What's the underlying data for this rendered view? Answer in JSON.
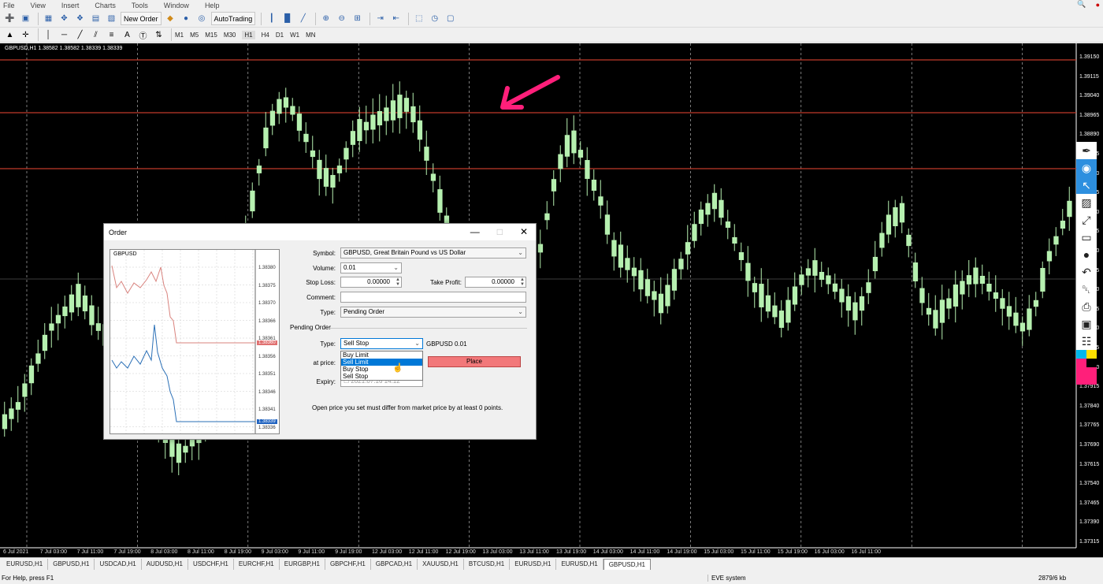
{
  "menu": [
    "File",
    "View",
    "Insert",
    "Charts",
    "Tools",
    "Window",
    "Help"
  ],
  "toolbar": {
    "new_order": "New Order",
    "auto_trading": "AutoTrading",
    "timeframes": [
      "M1",
      "M5",
      "M15",
      "M30",
      "H1",
      "H4",
      "D1",
      "W1",
      "MN"
    ],
    "active_timeframe": "H1"
  },
  "chart": {
    "title": "GBPUSD,H1  1.38582 1.38582 1.38339 1.38339",
    "price_labels": [
      "1.39150",
      "1.39115",
      "1.39040",
      "1.38965",
      "1.38890",
      "1.38815",
      "1.38740",
      "1.38665",
      "1.38590",
      "1.38515",
      "1.38440",
      "1.38365",
      "1.38290",
      "1.38215",
      "1.38140",
      "1.38065",
      "1.37990",
      "1.37915",
      "1.37840",
      "1.37765",
      "1.37690",
      "1.37615",
      "1.37540",
      "1.37465",
      "1.37390",
      "1.37315"
    ],
    "date_labels": [
      "6 Jul 2021",
      "7 Jul 03:00",
      "7 Jul 11:00",
      "7 Jul 19:00",
      "8 Jul 03:00",
      "8 Jul 11:00",
      "8 Jul 19:00",
      "9 Jul 03:00",
      "9 Jul 11:00",
      "9 Jul 19:00",
      "12 Jul 03:00",
      "12 Jul 11:00",
      "12 Jul 19:00",
      "13 Jul 03:00",
      "13 Jul 11:00",
      "13 Jul 19:00",
      "14 Jul 03:00",
      "14 Jul 11:00",
      "14 Jul 19:00",
      "15 Jul 03:00",
      "15 Jul 11:00",
      "15 Jul 19:00",
      "16 Jul 03:00",
      "16 Jul 11:00"
    ],
    "colors": {
      "background": "#000000",
      "candle": "#b6f0b0",
      "level_line": "#c0392b",
      "grid": "#ffffff",
      "annotation": "#ff1f7a"
    }
  },
  "dialog": {
    "title": "Order",
    "mini_chart_title": "GBPUSD",
    "mini_prices": [
      "1.38380",
      "1.38375",
      "1.38370",
      "1.38366",
      "1.38361",
      "1.38356",
      "1.38351",
      "1.38346",
      "1.38341",
      "1.38336"
    ],
    "ask_tag": "1.38360",
    "bid_tag": "1.38339",
    "symbol_label": "Symbol:",
    "symbol_value": "GBPUSD, Great Britain Pound vs US Dollar",
    "volume_label": "Volume:",
    "volume_value": "0.01",
    "stoploss_label": "Stop Loss:",
    "stoploss_value": "0.00000",
    "takeprofit_label": "Take Profit:",
    "takeprofit_value": "0.00000",
    "comment_label": "Comment:",
    "comment_value": "",
    "type_label": "Type:",
    "type_value": "Pending Order",
    "pending_section": "Pending Order",
    "pending_type_label": "Type:",
    "pending_type_value": "Sell Stop",
    "pending_symbol_info": "GBPUSD 0.01",
    "atprice_label": "at price:",
    "expiry_label": "Expiry:",
    "expiry_value": "2021.07.16 14:12",
    "pending_options": [
      "Buy Limit",
      "Sell Limit",
      "Buy Stop",
      "Sell Stop"
    ],
    "highlighted_option": "Sell Limit",
    "place_label": "Place",
    "note": "Open price you set must differ from market price by at least 0 points."
  },
  "tabs": [
    "EURUSD,H1",
    "GBPUSD,H1",
    "USDCAD,H1",
    "AUDUSD,H1",
    "USDCHF,H1",
    "EURCHF,H1",
    "EURGBP,H1",
    "GBPCHF,H1",
    "GBPCAD,H1",
    "XAUUSD,H1",
    "BTCUSD,H1",
    "EURUSD,H1",
    "EURUSD,H1",
    "GBPUSD,H1"
  ],
  "active_tab_index": 13,
  "status": {
    "help": "For Help, press F1",
    "profile": "EVE system",
    "traffic": "2879/6 kb"
  }
}
